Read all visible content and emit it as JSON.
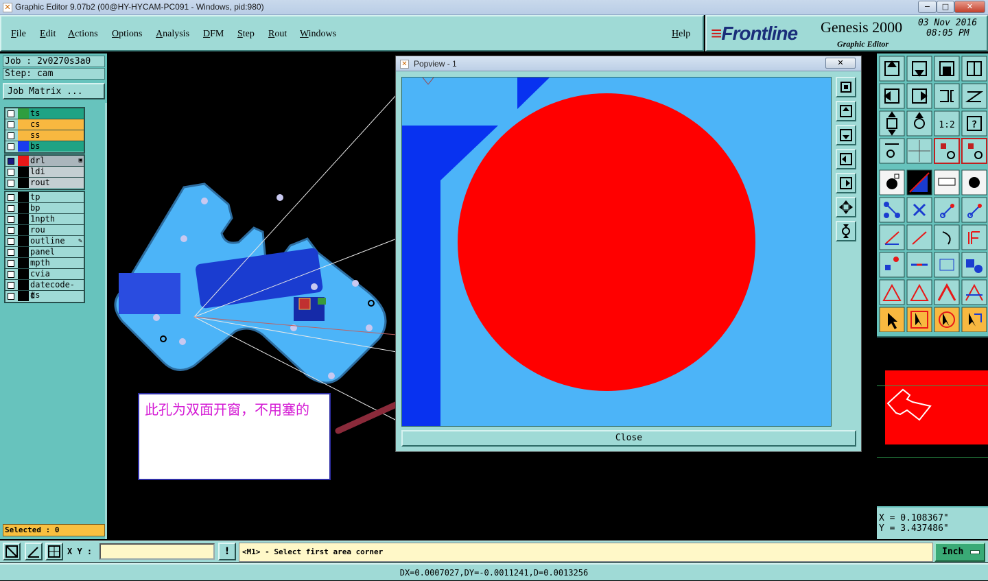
{
  "window": {
    "title": "Graphic Editor 9.07b2 (00@HY-HYCAM-PC091 - Windows, pid:980)",
    "min": "−",
    "max": "□",
    "close": "✕"
  },
  "menu": [
    "File",
    "Edit",
    "Actions",
    "Options",
    "Analysis",
    "DFM",
    "Step",
    "Rout",
    "Windows"
  ],
  "help_label": "Help",
  "brand": {
    "logo_prefix": "≡",
    "logo_text": "Frontline",
    "product": "Genesis 2000",
    "subtitle": "Graphic Editor",
    "date": "03 Nov 2016",
    "time": "08:05 PM"
  },
  "job": {
    "job_line": "Job : 2v0270s3a0",
    "step_line": "Step: cam",
    "matrix_button": "Job Matrix ..."
  },
  "layers": {
    "group1": [
      {
        "name": "ts",
        "color": "#2f9e3f",
        "bg": "#1fa384"
      },
      {
        "name": "cs",
        "color": "#f8b840",
        "bg": "#f8b840"
      },
      {
        "name": "ss",
        "color": "#f8b840",
        "bg": "#f8b840"
      },
      {
        "name": "bs",
        "color": "#1a3cf0",
        "bg": "#1fa384"
      }
    ],
    "group2": [
      {
        "name": "drl",
        "color": "#e81818",
        "bg": "#aab6bc",
        "flag": "▣"
      },
      {
        "name": "ldi",
        "color": "#000000",
        "bg": "#c4cfd2"
      },
      {
        "name": "rout",
        "color": "#000000",
        "bg": "#c4cfd2"
      }
    ],
    "group3": [
      {
        "name": "tp"
      },
      {
        "name": "bp"
      },
      {
        "name": "1npth"
      },
      {
        "name": "rou"
      },
      {
        "name": "outline",
        "flag": "✎"
      },
      {
        "name": "panel"
      },
      {
        "name": "mpth"
      },
      {
        "name": "cvia"
      },
      {
        "name": "datecode-ts"
      },
      {
        "name": "d"
      }
    ]
  },
  "selected_label": "Selected : 0",
  "popview": {
    "title": "Popview - 1",
    "close_x": "✕",
    "close_button": "Close"
  },
  "annotation": "此孔为双面开窗，不用塞的",
  "coords": {
    "x": "X = 0.108367\"",
    "y": "Y = 3.437486\""
  },
  "bottom": {
    "xy_label": "X Y :",
    "xy_value": "",
    "message": "<M1> - Select first area corner",
    "unit": "Inch",
    "excl": "!"
  },
  "status": "DX=0.0007027,DY=-0.0011241,D=0.0013256"
}
